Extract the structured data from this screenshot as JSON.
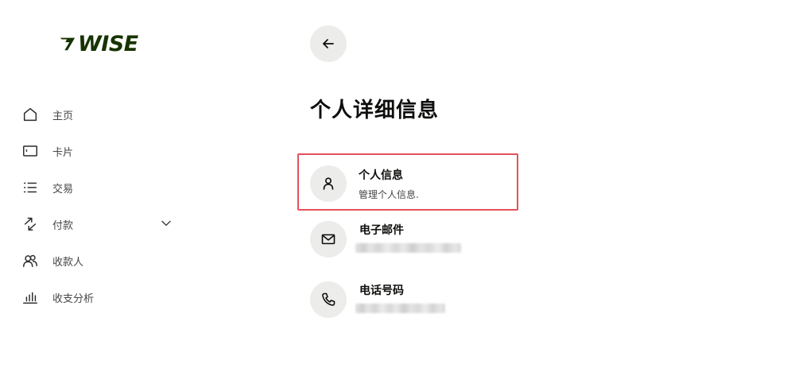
{
  "brand": {
    "name": "WISE",
    "color": "#163300"
  },
  "sidebar": {
    "items": [
      {
        "icon": "home-icon",
        "label": "主页"
      },
      {
        "icon": "card-icon",
        "label": "卡片"
      },
      {
        "icon": "list-icon",
        "label": "交易"
      },
      {
        "icon": "transfer-arrows-icon",
        "label": "付款",
        "has_dropdown": true
      },
      {
        "icon": "recipients-icon",
        "label": "收款人"
      },
      {
        "icon": "bar-chart-icon",
        "label": "收支分析"
      }
    ]
  },
  "main": {
    "back_icon": "arrow-left-icon",
    "title": "个人详细信息",
    "items": [
      {
        "icon": "person-icon",
        "title": "个人信息",
        "subtitle": "管理个人信息.",
        "highlighted": true
      },
      {
        "icon": "envelope-icon",
        "title": "电子邮件",
        "subtitle_redacted": true
      },
      {
        "icon": "phone-icon",
        "title": "电话号码",
        "subtitle_redacted": true
      }
    ]
  },
  "colors": {
    "highlight_border": "#e4515a",
    "icon_circle_bg": "#ececea",
    "text_primary": "#0e0f0c",
    "text_secondary": "#454745"
  }
}
